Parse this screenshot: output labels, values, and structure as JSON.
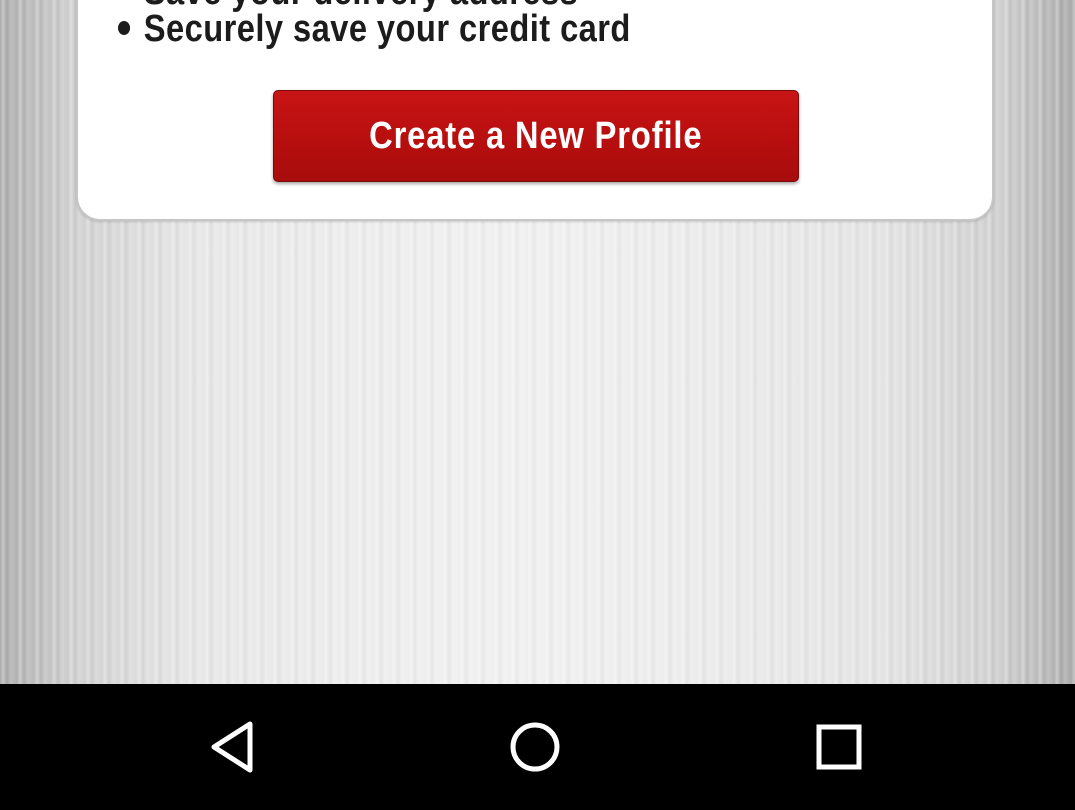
{
  "card": {
    "bullets": [
      "Save your delivery address",
      "Securely save your credit card"
    ],
    "create_profile_label": "Create a New Profile"
  },
  "colors": {
    "button_red": "#b90f0f",
    "card_background": "#ffffff",
    "nav_bar": "#000000",
    "nav_icons": "#ffffff"
  },
  "navigation": {
    "back_icon": "triangle-back-icon",
    "home_icon": "circle-home-icon",
    "recents_icon": "square-recents-icon"
  }
}
